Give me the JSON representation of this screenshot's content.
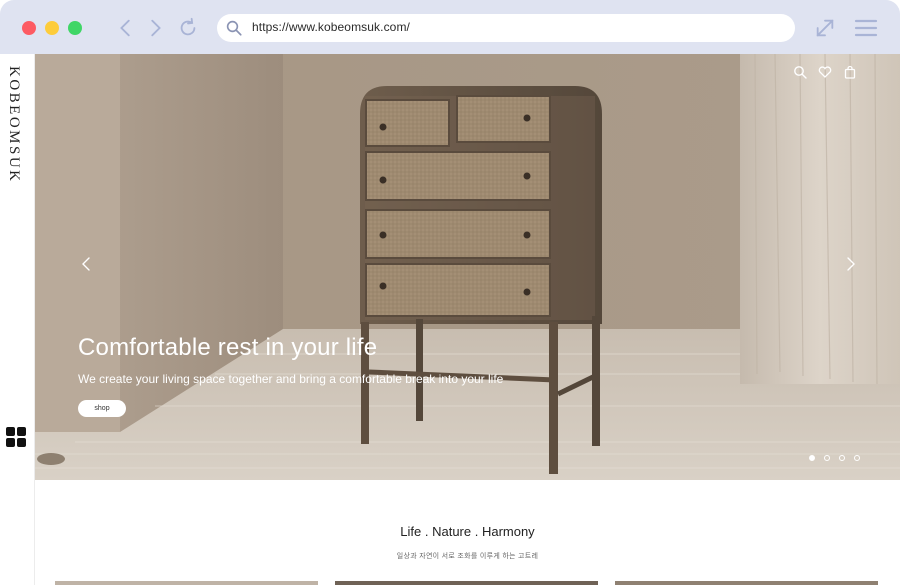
{
  "browser": {
    "url": "https://www.kobeomsuk.com/"
  },
  "brand": {
    "name": "KOBEOMSUK"
  },
  "hero": {
    "title": "Comfortable rest in your life",
    "subtitle": "We create your living space together and bring a comfortable break into your life",
    "button_label": "shop",
    "slides_count": 4,
    "active_slide": 1
  },
  "section": {
    "tagline": "Life . Nature . Harmony",
    "tagline_ko": "일상과 자연이 서로 조화를 이루게 하는 고트레"
  },
  "colors": {
    "frame": "#dfe3f1",
    "accent_icon": "#a9b4d6",
    "wall": "#a89888",
    "floor": "#c9bfb2"
  },
  "icons": {
    "search": "search-icon",
    "heart": "heart-icon",
    "bag": "shopping-bag-icon",
    "grid": "grid-icon"
  }
}
